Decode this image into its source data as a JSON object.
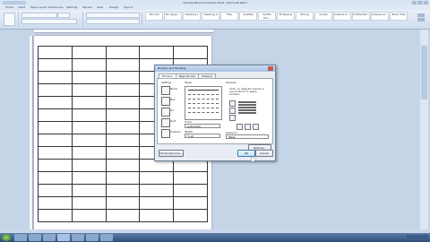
{
  "window": {
    "title": "Sample Word Document Chart - Microsoft Word"
  },
  "ribbon": {
    "tabs": [
      "Home",
      "Insert",
      "Page Layout",
      "References",
      "Mailings",
      "Review",
      "View",
      "Design",
      "Layout"
    ],
    "styles": [
      "Normal",
      "No Spaci...",
      "Heading 1",
      "Heading 2",
      "Title",
      "Subtitle",
      "Subtle Em...",
      "Emphasis",
      "Strong",
      "Quote",
      "Intense Q...",
      "Subtle Ref...",
      "Intense R...",
      "Book Title"
    ]
  },
  "dialog": {
    "title": "Borders and Shading",
    "tabs": [
      "Borders",
      "Page Border",
      "Shading"
    ],
    "setting_label": "Setting:",
    "settings": [
      "None",
      "Box",
      "All",
      "Grid",
      "Custom"
    ],
    "style_label": "Style:",
    "color_label": "Color:",
    "color_value": "Automatic",
    "width_label": "Width:",
    "width_value": "½ pt",
    "preview_label": "Preview",
    "preview_note": "Click on diagram below or use buttons to apply borders",
    "apply_label": "Apply to:",
    "apply_value": "Table",
    "options_button": "Options...",
    "horizontal_line_button": "Horizontal Line...",
    "ok_button": "OK",
    "cancel_button": "Cancel"
  },
  "taskbar": {
    "start_label": "Start",
    "apps": [
      "ie",
      "folder",
      "media",
      "word",
      "paint",
      "chrome",
      "app"
    ]
  }
}
